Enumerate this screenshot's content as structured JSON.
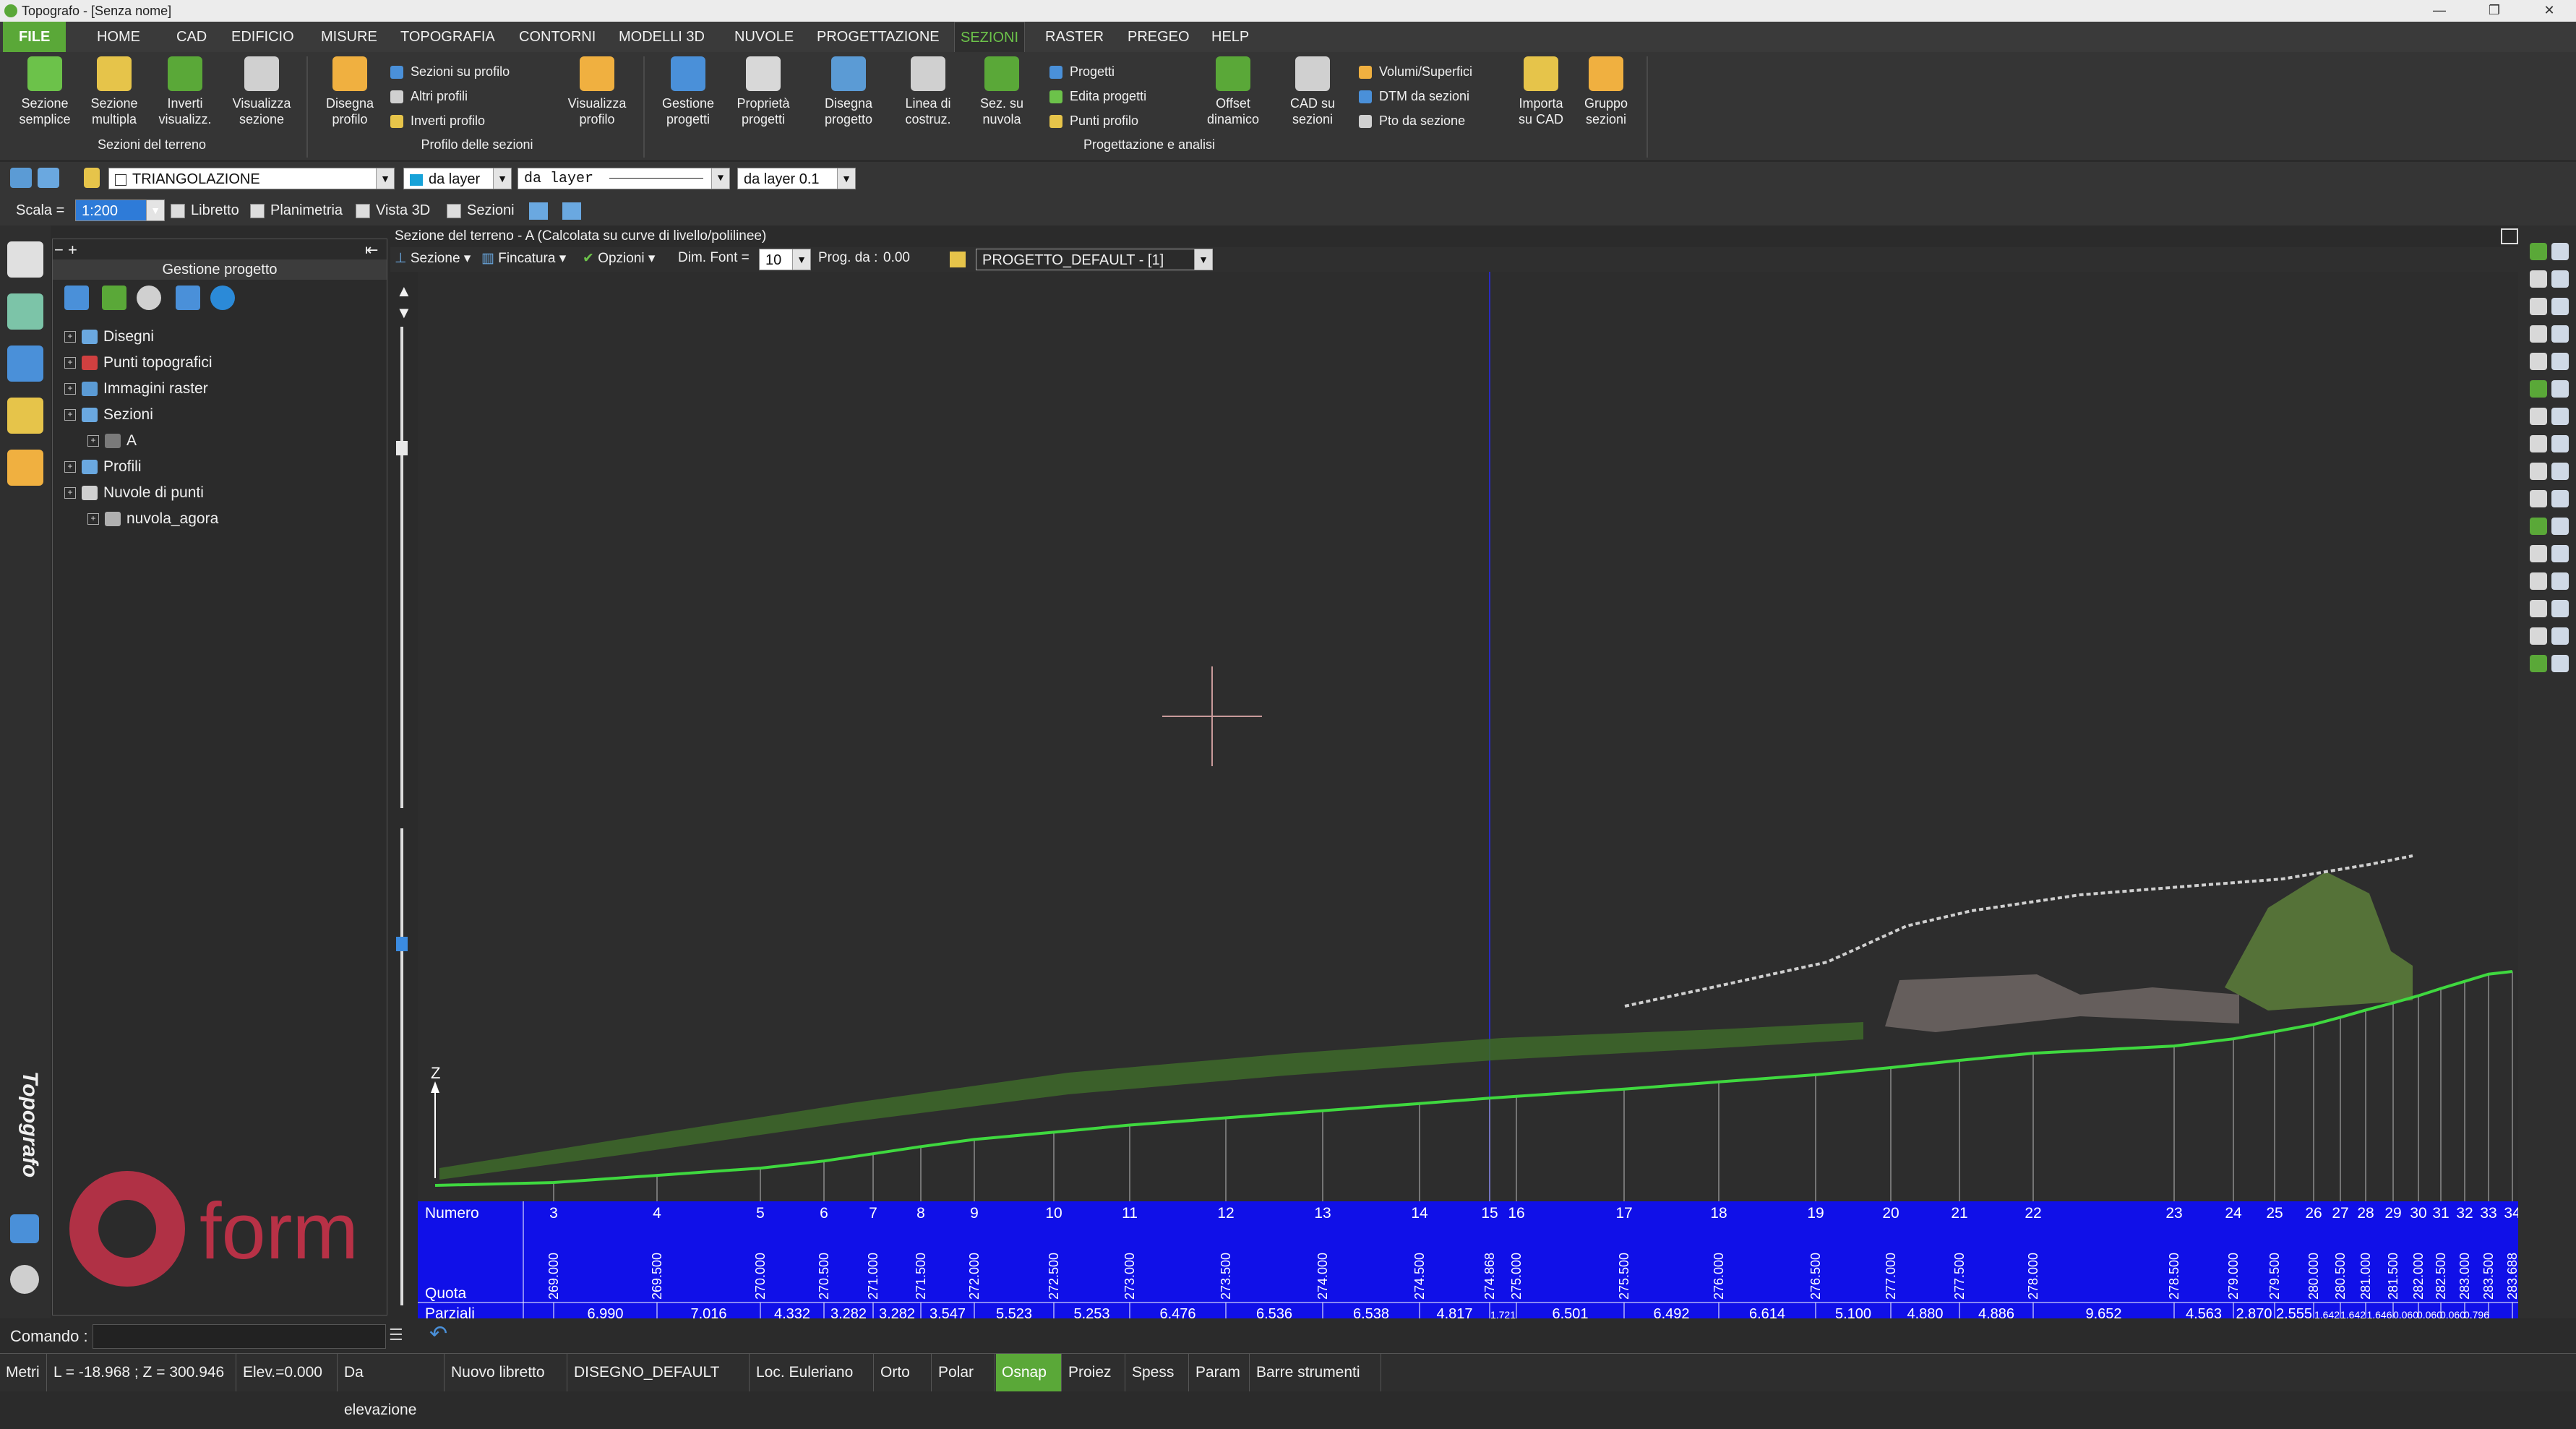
{
  "window": {
    "title": "Topografo - [Senza nome]"
  },
  "menu": [
    "FILE",
    "HOME",
    "CAD",
    "EDIFICIO",
    "MISURE",
    "TOPOGRAFIA",
    "CONTORNI",
    "MODELLI 3D",
    "NUVOLE",
    "PROGETTAZIONE",
    "SEZIONI",
    "RASTER",
    "PREGEO",
    "HELP"
  ],
  "menu_active": "SEZIONI",
  "ribbon": {
    "groups": [
      {
        "label": "Sezioni del terreno",
        "buttons": [
          [
            "Sezione",
            "semplice"
          ],
          [
            "Sezione",
            "multipla"
          ],
          [
            "Inverti",
            "visualizz."
          ],
          [
            "Visualizza",
            "sezione"
          ]
        ]
      },
      {
        "label": "Profilo delle sezioni",
        "buttons": [
          [
            "Disegna",
            "profilo"
          ]
        ],
        "small": [
          "Sezioni su profilo",
          "Altri profili",
          "Inverti profilo"
        ],
        "buttons2": [
          [
            "Visualizza",
            "profilo"
          ]
        ]
      },
      {
        "label": "Progettazione e analisi",
        "buttons": [
          [
            "Gestione",
            "progetti"
          ],
          [
            "Proprietà",
            "progetti"
          ],
          [
            "Disegna",
            "progetto"
          ],
          [
            "Linea di",
            "costruz."
          ],
          [
            "Sez. su",
            "nuvola"
          ]
        ],
        "small": [
          "Progetti",
          "Edita progetti",
          "Punti profilo"
        ],
        "buttons2": [
          [
            "Offset",
            "dinamico"
          ],
          [
            "CAD su",
            "sezioni"
          ]
        ],
        "small2": [
          "Volumi/Superfici",
          "DTM da sezioni",
          "Pto da sezione"
        ],
        "buttons3": [
          [
            "Importa",
            "su CAD"
          ],
          [
            "Gruppo",
            "sezioni"
          ]
        ]
      }
    ]
  },
  "toolbar1": {
    "layer": "TRIANGOLAZIONE",
    "color": "da layer",
    "linetype": "da layer",
    "lineweight": "da layer 0.1"
  },
  "toolbar2": {
    "scale_label": "Scala =",
    "scale_value": "1:200",
    "checks": [
      "Libretto",
      "Planimetria",
      "Vista 3D",
      "Sezioni"
    ]
  },
  "panel": {
    "title": "Gestione progetto",
    "tree": [
      {
        "label": "Disegni",
        "level": 0
      },
      {
        "label": "Punti topografici",
        "level": 0
      },
      {
        "label": "Immagini raster",
        "level": 0
      },
      {
        "label": "Sezioni",
        "level": 0
      },
      {
        "label": "A",
        "level": 1
      },
      {
        "label": "Profili",
        "level": 0
      },
      {
        "label": "Nuvole di punti",
        "level": 0
      },
      {
        "label": "nuvola_agora",
        "level": 1
      }
    ]
  },
  "viewport": {
    "title": "Sezione del terreno - A (Calcolata su curve di livello/polilinee)",
    "tools": {
      "sezione": "Sezione",
      "fincatura": "Fincatura",
      "opzioni": "Opzioni",
      "dim_font_label": "Dim. Font =",
      "dim_font_value": "10",
      "prog_label": "Prog. da :",
      "prog_value": "0.00",
      "project": "PROGETTO_DEFAULT - [1]"
    },
    "axis_label": "Z",
    "table": {
      "row_labels": [
        "Numero",
        "Quota",
        "Parziali"
      ],
      "numbers": [
        "3",
        "4",
        "5",
        "6",
        "7",
        "8",
        "9",
        "10",
        "11",
        "12",
        "13",
        "14",
        "15",
        "16",
        "17",
        "18",
        "19",
        "20",
        "21",
        "22",
        "23",
        "24",
        "25",
        "26",
        "27",
        "28",
        "29",
        "30",
        "31",
        "32",
        "33",
        "34"
      ],
      "quotas": [
        "269.000",
        "269.500",
        "270.000",
        "270.500",
        "271.000",
        "271.500",
        "272.000",
        "272.500",
        "273.000",
        "273.500",
        "274.000",
        "274.500",
        "274.868",
        "275.000",
        "275.500",
        "276.000",
        "276.500",
        "277.000",
        "277.500",
        "278.000",
        "278.500",
        "279.000",
        "279.500",
        "280.000",
        "280.500",
        "281.000",
        "281.500",
        "282.000",
        "282.500",
        "283.000",
        "283.500",
        "283.688"
      ],
      "partials": [
        "6.990",
        "7.016",
        "4.332",
        "3.282",
        "3.282",
        "3.547",
        "5.523",
        "5.253",
        "6.476",
        "6.536",
        "6.538",
        "4.817",
        "1.721",
        "6.501",
        "6.492",
        "6.614",
        "5.100",
        "4.880",
        "4.886",
        "9.652",
        "4.563",
        "2.870",
        "2.555",
        "1.642",
        "1.642",
        "1.646",
        "0.060",
        "0.060",
        "0.060",
        "0.796"
      ]
    }
  },
  "command": {
    "label": "Comando :"
  },
  "status": [
    "Metri",
    "L = -18.968 ; Z = 300.946",
    "Elev.=0.000",
    "Da elevazione",
    "Nuovo libretto",
    "DISEGNO_DEFAULT",
    "Loc. Euleriano",
    "Orto",
    "Polar",
    "Osnap",
    "Proiez",
    "Spess",
    "Param",
    "Barre strumenti"
  ],
  "status_active": "Osnap",
  "logo_text": "form",
  "sidebar_vertical_label": "Topografo",
  "colors": {
    "accent": "#5aa838",
    "table_bg": "#1010e8",
    "terrain": "#3fd83f",
    "crosshair_line": "#2a2ac0"
  }
}
